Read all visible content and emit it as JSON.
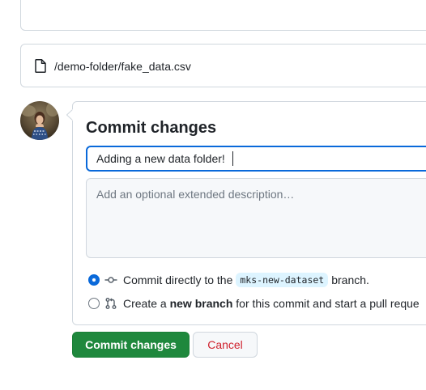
{
  "file": {
    "path": "/demo-folder/fake_data.csv",
    "icon": "file-icon"
  },
  "commit": {
    "title": "Commit changes",
    "summary_value": "Adding a new data folder!",
    "description_placeholder": "Add an optional extended description…",
    "option_direct": {
      "prefix": "Commit directly to the",
      "branch": "mks-new-dataset",
      "suffix": "branch.",
      "icon": "git-commit-icon",
      "selected": true
    },
    "option_new_branch": {
      "prefix": "Create a",
      "bold": "new branch",
      "suffix": "for this commit and start a pull reque",
      "icon": "git-pull-request-icon",
      "selected": false
    }
  },
  "buttons": {
    "commit_label": "Commit changes",
    "cancel_label": "Cancel"
  },
  "colors": {
    "accent": "#0969da",
    "primary_button": "#1f883d",
    "danger_text": "#cf222e",
    "border": "#d0d7de",
    "branch_chip": "#ddf4ff"
  }
}
